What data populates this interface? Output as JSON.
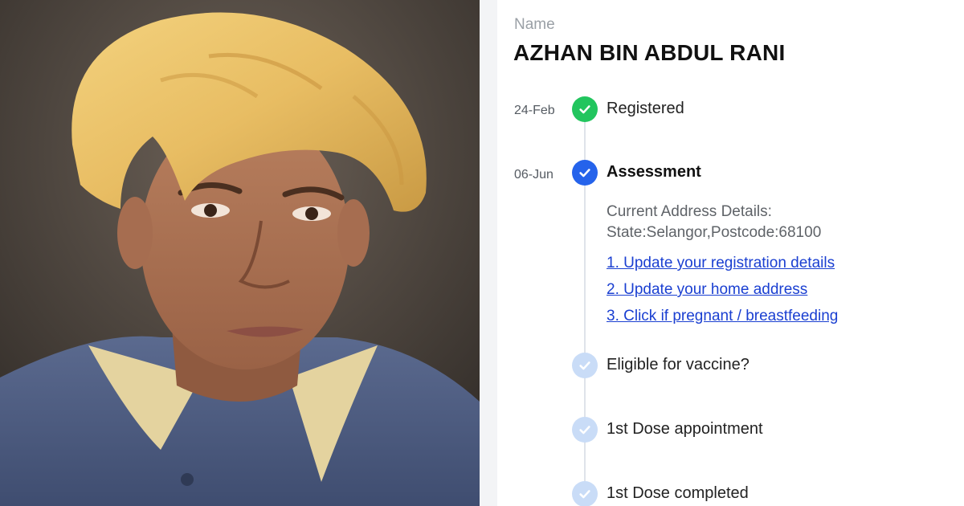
{
  "photo": {
    "subject": "portrait-photo"
  },
  "profile": {
    "name_label": "Name",
    "name_value": "AZHAN BIN ABDUL RANI"
  },
  "timeline": {
    "steps": [
      {
        "date": "24-Feb",
        "label": "Registered",
        "state": "complete",
        "color": "#22c55e"
      },
      {
        "date": "06-Jun",
        "label": "Assessment",
        "state": "current",
        "color": "#2563eb"
      },
      {
        "date": "",
        "label": "Eligible for vaccine?",
        "state": "pending",
        "color": "#c9dcf7"
      },
      {
        "date": "",
        "label": "1st Dose appointment",
        "state": "pending",
        "color": "#c9dcf7"
      },
      {
        "date": "",
        "label": "1st Dose completed",
        "state": "pending",
        "color": "#c9dcf7"
      }
    ],
    "assessment": {
      "address_line1": "Current Address Details:",
      "address_line2": "State:Selangor,Postcode:68100",
      "links": [
        "1. Update your registration details",
        "2. Update your home address",
        "3. Click if pregnant / breastfeeding"
      ]
    }
  },
  "colors": {
    "link": "#1a3fd1",
    "timeline_line": "#dfe3ea"
  }
}
